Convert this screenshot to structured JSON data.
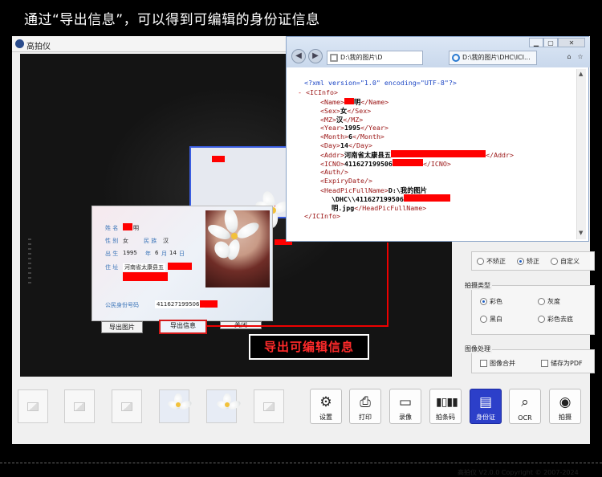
{
  "headline": "通过“导出信息”，可以得到可编辑的身份证信息",
  "app": {
    "title": "高拍仪",
    "copyright": "高拍仪 V2.0.0 Copyright © 2007-2024"
  },
  "id_card": {
    "name_label": "姓 名",
    "name_value": "明",
    "sex_label": "性 别",
    "sex_value": "女",
    "ethnic_label": "民 族",
    "ethnic_value": "汉",
    "birth_label": "出 生",
    "birth_year": "1995",
    "birth_year_unit": "年",
    "birth_month": "6",
    "birth_month_unit": "月",
    "birth_day": "14",
    "birth_day_unit": "日",
    "addr_label": "住 址",
    "addr_value": "河南省太康县五",
    "id_label": "公民身份号码",
    "id_value": "4116271995061"
  },
  "dialog_buttons": {
    "export_image": "导出图片",
    "export_info": "导出信息",
    "close": "关闭"
  },
  "callout": "导出可编辑信息",
  "xml_window": {
    "address": "D:\\我的图片\\D",
    "tab_label": "D:\\我的图片\\DHC\\ICI...",
    "decl": "<?xml version=\"1.0\" encoding=\"UTF-8\"?>",
    "root_open": "<ICInfo>",
    "root_close": "</ICInfo>",
    "minus": "-",
    "name_open": "<Name>",
    "name_text": "明",
    "name_close": "</Name>",
    "sex_open": "<Sex>",
    "sex_text": "女",
    "sex_close": "</Sex>",
    "mz_open": "<MZ>",
    "mz_text": "汉",
    "mz_close": "</MZ>",
    "year_open": "<Year>",
    "year_text": "1995",
    "year_close": "</Year>",
    "month_open": "<Month>",
    "month_text": "6",
    "month_close": "</Month>",
    "day_open": "<Day>",
    "day_text": "14",
    "day_close": "</Day>",
    "addr_open": "<Addr>",
    "addr_text": "河南省太康县五",
    "addr_close": "</Addr>",
    "icno_open": "<ICNO>",
    "icno_text": "411627199506",
    "icno_close": "</ICNO>",
    "auth": "<Auth/>",
    "expiry": "<ExpiryDate/>",
    "headpic_open": "<HeadPicFullName>",
    "headpic_text1": "D:\\我的图片",
    "headpic_text2": "\\DHC\\\\411627199506",
    "headpic_text3": "明.jpg",
    "headpic_close": "</HeadPicFullName>"
  },
  "correction": {
    "options": [
      "不矫正",
      "矫正",
      "自定义"
    ],
    "selected": "矫正"
  },
  "shoot_type": {
    "title": "拍摄类型",
    "options": [
      "彩色",
      "灰度",
      "黑白",
      "彩色去底"
    ],
    "selected": "彩色"
  },
  "image_process": {
    "title": "图像处理",
    "options": [
      "图像合并",
      "储存为PDF"
    ]
  },
  "toolbar": {
    "settings": "设置",
    "print": "打印",
    "record": "录像",
    "barcode": "拍条码",
    "idcard": "身份证",
    "ocr": "OCR",
    "capture": "拍摄"
  },
  "colors": {
    "accent": "#2c3fc9",
    "callout_text": "#ff2a2a",
    "redaction": "#ff0000"
  }
}
